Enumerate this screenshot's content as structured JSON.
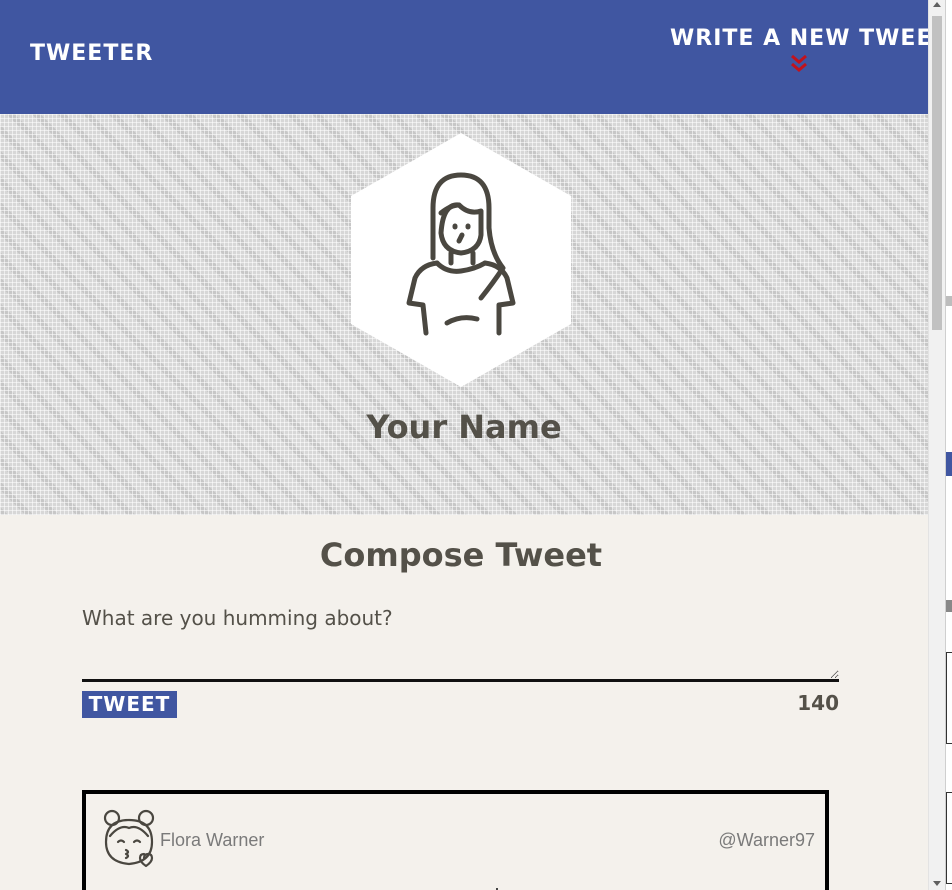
{
  "nav": {
    "brand": "Tweeter",
    "compose_label": "Write a new tweet",
    "compose_icon": "double-chevron-down-icon"
  },
  "profile": {
    "name": "Your Name",
    "avatar_icon": "woman-avatar-icon"
  },
  "compose": {
    "title": "Compose Tweet",
    "placeholder": "What are you humming about?",
    "value": "",
    "submit_label": "Tweet",
    "counter": "140"
  },
  "tweets": [
    {
      "author": "Flora Warner",
      "handle": "@Warner97",
      "avatar_icon": "girl-kiss-avatar-icon"
    }
  ],
  "colors": {
    "nav_bg": "#4056a1",
    "accent_red": "#c3121b",
    "text": "#545149",
    "page_bg": "#f4f1ec"
  }
}
